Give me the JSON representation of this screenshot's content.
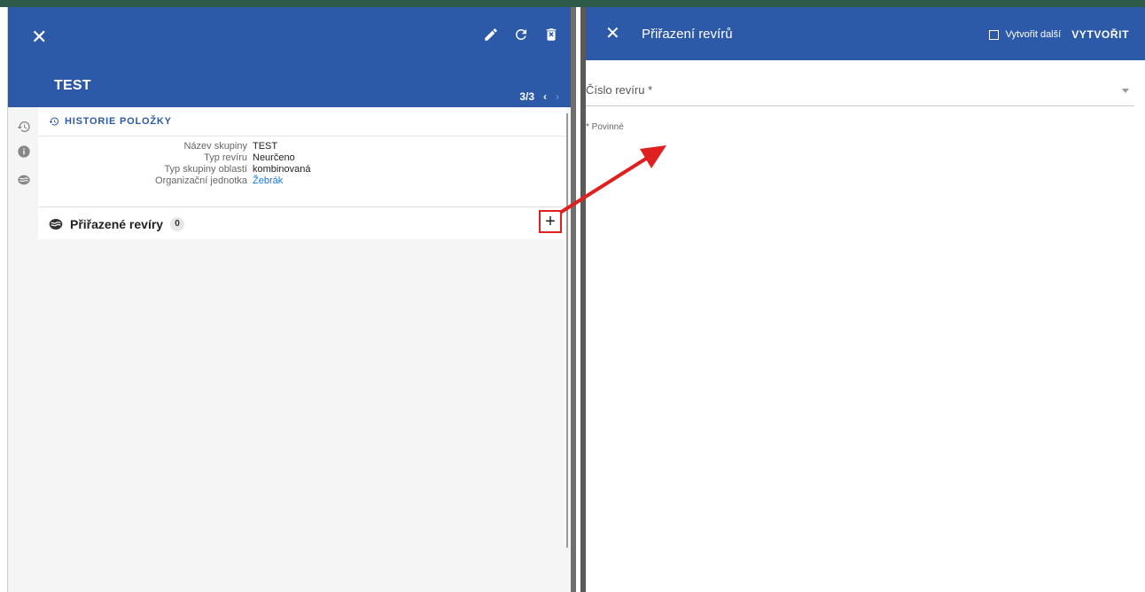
{
  "left_panel": {
    "title": "TEST",
    "pager": "3/3",
    "pager_prev": "‹",
    "pager_next": "›",
    "close": "✕",
    "history_heading": "HISTORIE POLOŽKY",
    "details": [
      {
        "key": "Název skupiny",
        "value": "TEST"
      },
      {
        "key": "Typ revíru",
        "value": "Neurčeno"
      },
      {
        "key": "Typ skupiny oblastí",
        "value": "kombinovaná"
      },
      {
        "key": "Organizační jednotka",
        "value": "Žebrák"
      }
    ],
    "assigned_title": "Přiřazené revíry",
    "assigned_count": "0",
    "add": "+"
  },
  "right_panel": {
    "close": "✕",
    "title": "Přiřazení revírů",
    "create_another": "Vytvořit další",
    "create": "VYTVOŘIT",
    "field_label": "Číslo revíru *",
    "required_note": "* Povinné"
  },
  "colors": {
    "header_blue": "#2c5aa8",
    "link_blue": "#1976d2",
    "highlight_red": "#e02020"
  }
}
